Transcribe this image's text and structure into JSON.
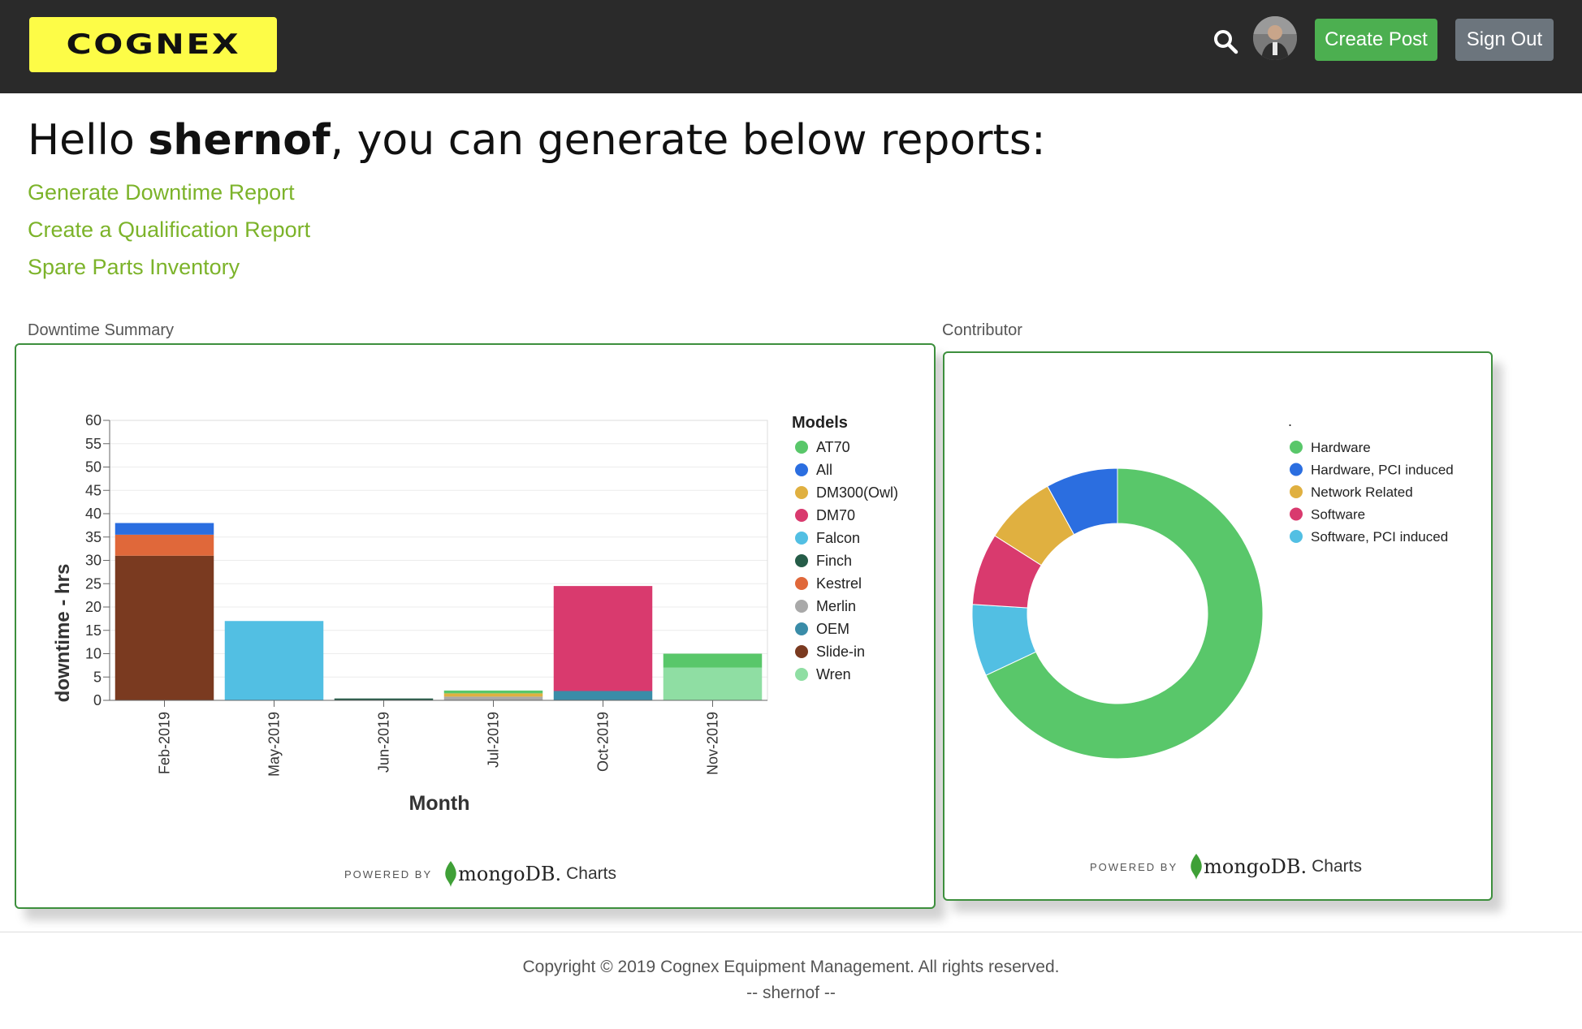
{
  "header": {
    "logo_text": "COGNEX",
    "create_post_label": "Create Post",
    "sign_out_label": "Sign Out",
    "colors": {
      "bar": "#2a2a2a",
      "logo_bg": "#fdfc47",
      "create": "#4caf50",
      "signout": "#6c757d"
    }
  },
  "main": {
    "greeting_prefix": "Hello ",
    "username": "shernof",
    "greeting_suffix": ", you can generate below reports:",
    "links": [
      "Generate Downtime Report",
      "Create a Qualification Report",
      "Spare Parts Inventory"
    ],
    "link_color": "#7cb32a"
  },
  "downtime_panel": {
    "label": "Downtime Summary",
    "powered_by": "POWERED BY",
    "mongo": "mongoDB.",
    "charts": "Charts"
  },
  "contributor_panel": {
    "label": "Contributor",
    "legend_title": ".",
    "powered_by": "POWERED BY",
    "mongo": "mongoDB.",
    "charts": "Charts"
  },
  "chart_data": [
    {
      "type": "bar",
      "stacked": true,
      "xlabel": "Month",
      "ylabel": "downtime - hrs",
      "ylim": [
        0,
        60
      ],
      "yticks": [
        0,
        5,
        10,
        15,
        20,
        25,
        30,
        35,
        40,
        45,
        50,
        55,
        60
      ],
      "categories": [
        "Feb-2019",
        "May-2019",
        "Jun-2019",
        "Jul-2019",
        "Oct-2019",
        "Nov-2019"
      ],
      "legend_title": "Models",
      "series": [
        {
          "name": "AT70",
          "color": "#59c76a",
          "values": [
            0,
            0,
            0,
            0.6,
            0,
            3
          ]
        },
        {
          "name": "All",
          "color": "#2b6ee0",
          "values": [
            2.5,
            0,
            0,
            0,
            0,
            0
          ]
        },
        {
          "name": "DM300(Owl)",
          "color": "#e0b040",
          "values": [
            0,
            0,
            0,
            0.7,
            0,
            0
          ]
        },
        {
          "name": "DM70",
          "color": "#d93a6e",
          "values": [
            0,
            0,
            0,
            0,
            22.5,
            0
          ]
        },
        {
          "name": "Falcon",
          "color": "#52bfe3",
          "values": [
            0,
            17,
            0,
            0,
            0,
            0
          ]
        },
        {
          "name": "Finch",
          "color": "#255c48",
          "values": [
            0,
            0,
            0.4,
            0,
            0,
            0
          ]
        },
        {
          "name": "Kestrel",
          "color": "#e0683a",
          "values": [
            4.5,
            0,
            0,
            0,
            0,
            0
          ]
        },
        {
          "name": "Merlin",
          "color": "#a9a9a9",
          "values": [
            0,
            0,
            0,
            0.8,
            0,
            0
          ]
        },
        {
          "name": "OEM",
          "color": "#3a8ca8",
          "values": [
            0,
            0,
            0,
            0,
            2,
            0
          ]
        },
        {
          "name": "Slide-in",
          "color": "#7a3a20",
          "values": [
            31,
            0,
            0,
            0,
            0,
            0
          ]
        },
        {
          "name": "Wren",
          "color": "#8fdea3",
          "values": [
            0,
            0,
            0,
            0,
            0,
            7
          ]
        }
      ]
    },
    {
      "type": "pie",
      "donut": true,
      "series": [
        {
          "name": "Hardware",
          "color": "#59c76a",
          "value": 68
        },
        {
          "name": "Software, PCI induced",
          "color": "#52bfe3",
          "value": 8
        },
        {
          "name": "Software",
          "color": "#d93a6e",
          "value": 8
        },
        {
          "name": "Network Related",
          "color": "#e0b040",
          "value": 8
        },
        {
          "name": "Hardware, PCI induced",
          "color": "#2b6ee0",
          "value": 8
        }
      ],
      "legend_order": [
        "Hardware",
        "Hardware, PCI induced",
        "Network Related",
        "Software",
        "Software, PCI induced"
      ]
    }
  ],
  "footer": {
    "copyright": "Copyright © 2019 Cognex Equipment Management. All rights reserved.",
    "user_line": "-- shernof --"
  }
}
